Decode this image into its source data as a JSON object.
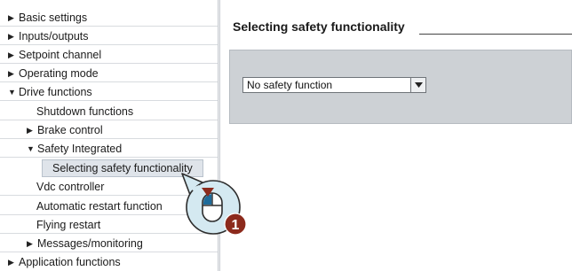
{
  "nav": {
    "items": [
      {
        "label": "Basic settings",
        "arrow": "▶",
        "level": 0
      },
      {
        "label": "Inputs/outputs",
        "arrow": "▶",
        "level": 0
      },
      {
        "label": "Setpoint channel",
        "arrow": "▶",
        "level": 0
      },
      {
        "label": "Operating mode",
        "arrow": "▶",
        "level": 0
      },
      {
        "label": "Drive functions",
        "arrow": "▼",
        "level": 0
      },
      {
        "label": "Shutdown functions",
        "arrow": "",
        "level": 1
      },
      {
        "label": "Brake control",
        "arrow": "▶",
        "level": 1
      },
      {
        "label": "Safety Integrated",
        "arrow": "▼",
        "level": 1
      },
      {
        "label": "Selecting safety functionality",
        "arrow": "",
        "level": 2
      },
      {
        "label": "Vdc controller",
        "arrow": "",
        "level": 1
      },
      {
        "label": "Automatic restart function",
        "arrow": "",
        "level": 1
      },
      {
        "label": "Flying restart",
        "arrow": "",
        "level": 1
      },
      {
        "label": "Messages/monitoring",
        "arrow": "▶",
        "level": 1
      },
      {
        "label": "Application functions",
        "arrow": "▶",
        "level": 0
      }
    ],
    "selected_index": 8
  },
  "panel": {
    "title": "Selecting safety functionality",
    "dropdown_value": "No safety function",
    "dropdown_arrow": "▼"
  },
  "callout": {
    "step_number": "1",
    "icon": "mouse-click-icon"
  },
  "colors": {
    "group_box": "#cdd1d5",
    "selected_row": "#dfe4ea",
    "callout_fill": "#d4e9f1",
    "callout_border": "#2d2d2d",
    "badge": "#8c2a1c",
    "mouse_button": "#1e6b9a"
  }
}
